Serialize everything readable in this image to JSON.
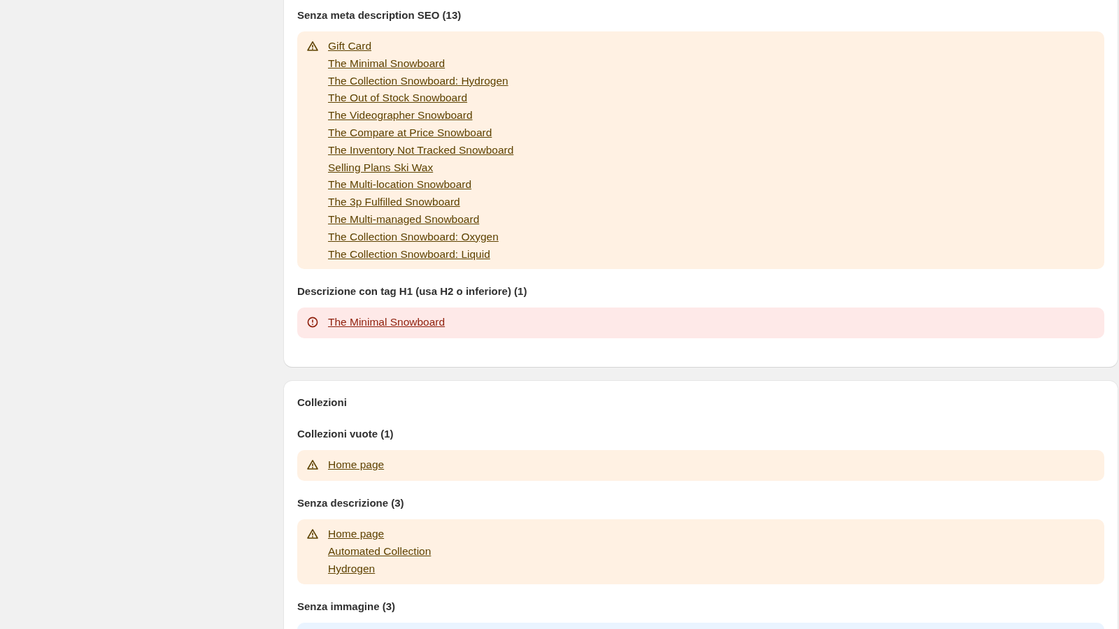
{
  "cards": [
    {
      "groups": [
        {
          "heading": "Senza meta description SEO (13)",
          "kind": "warning",
          "items": [
            "Gift Card",
            "The Minimal Snowboard",
            "The Collection Snowboard: Hydrogen",
            "The Out of Stock Snowboard",
            "The Videographer Snowboard",
            "The Compare at Price Snowboard",
            "The Inventory Not Tracked Snowboard",
            "Selling Plans Ski Wax",
            "The Multi-location Snowboard",
            "The 3p Fulfilled Snowboard",
            "The Multi-managed Snowboard",
            "The Collection Snowboard: Oxygen",
            "The Collection Snowboard: Liquid"
          ]
        },
        {
          "heading": "Descrizione con tag H1 (usa H2 o inferiore) (1)",
          "kind": "critical",
          "items": [
            "The Minimal Snowboard"
          ]
        }
      ]
    },
    {
      "title": "Collezioni",
      "groups": [
        {
          "heading": "Collezioni vuote (1)",
          "kind": "warning",
          "items": [
            "Home page"
          ]
        },
        {
          "heading": "Senza descrizione (3)",
          "kind": "warning",
          "items": [
            "Home page",
            "Automated Collection",
            "Hydrogen"
          ]
        },
        {
          "heading": "Senza immagine (3)",
          "kind": "info"
        }
      ]
    }
  ]
}
